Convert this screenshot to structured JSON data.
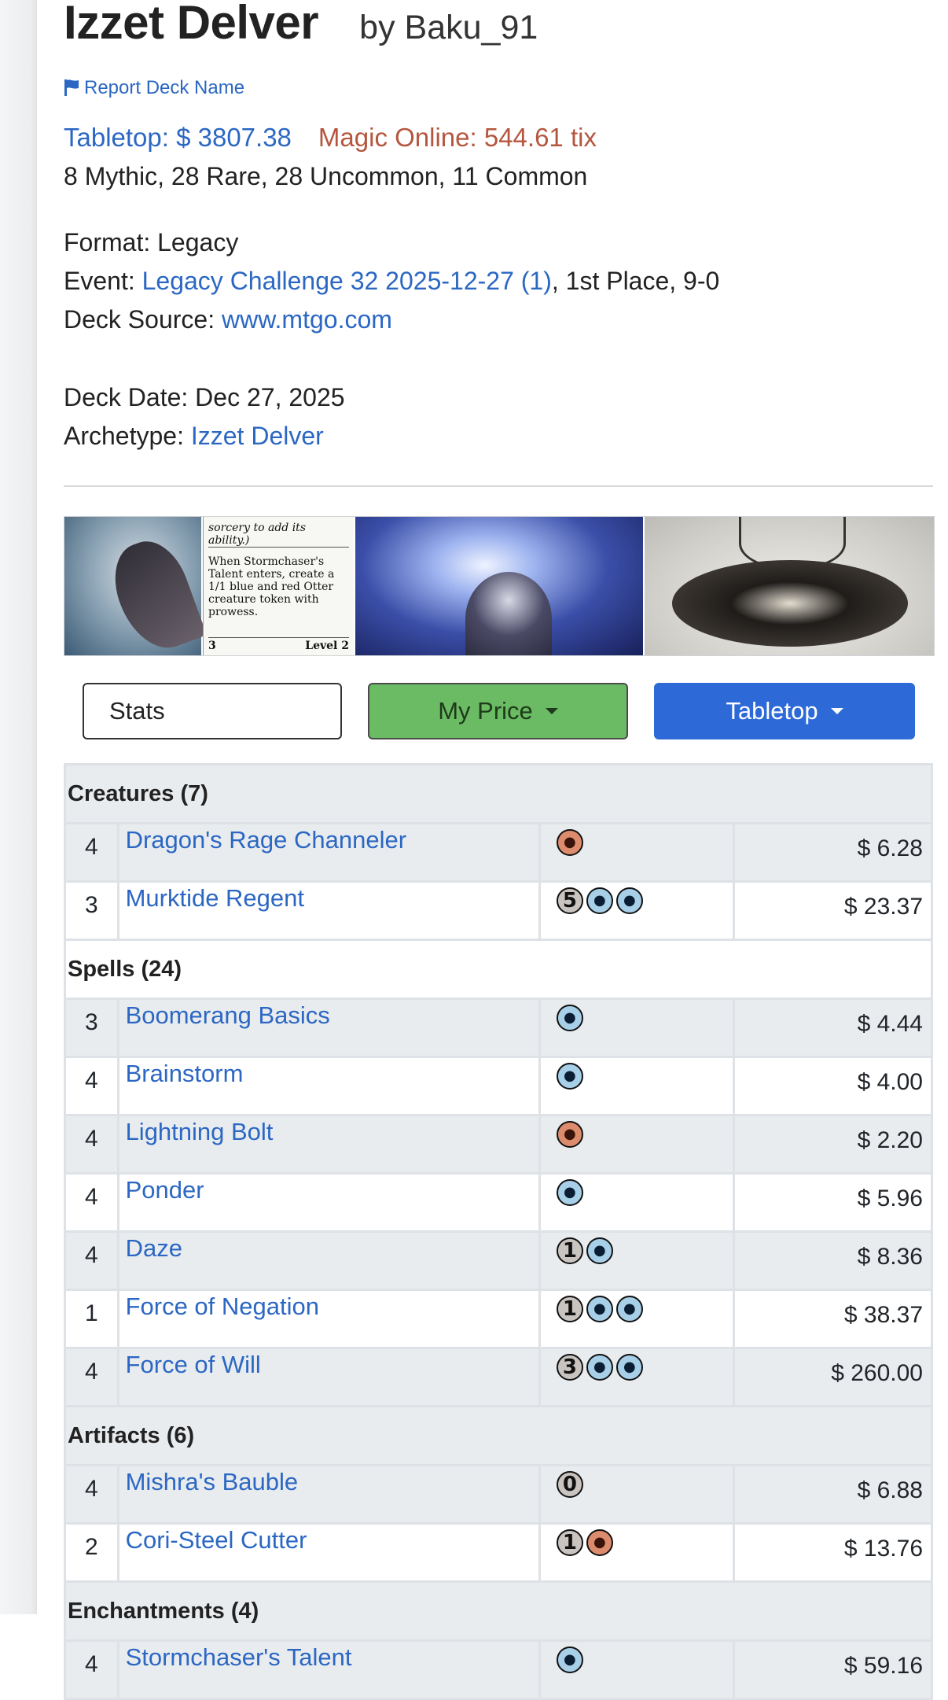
{
  "deck": {
    "title": "Izzet Delver",
    "byline": "by Baku_91",
    "report_link": "Report Deck Name",
    "tabletop_price": "Tabletop: $ 3807.38",
    "mtgo_price": "Magic Online: 544.61 tix",
    "rarity_summary": "8 Mythic, 28 Rare, 28 Uncommon, 11 Common",
    "format_label": "Format: Legacy",
    "event_label": "Event: ",
    "event_link": "Legacy Challenge 32 2025-12-27 (1)",
    "event_result": ", 1st Place, 9-0",
    "source_label": "Deck Source: ",
    "source_link": "www.mtgo.com",
    "date_label": "Deck Date: Dec 27, 2025",
    "archetype_label": "Archetype: ",
    "archetype_link": "Izzet Delver"
  },
  "card_image_text": {
    "ability_reminder": "sorcery to add its ability.)",
    "ability_text": "When Stormchaser's Talent enters, create a 1/1 blue and red Otter creature token with prowess.",
    "level_cost": "3",
    "level_label": "Level 2"
  },
  "buttons": {
    "stats": "Stats",
    "my_price": "My Price",
    "tabletop": "Tabletop"
  },
  "colors": {
    "link": "#2b67c3",
    "mtgo": "#b5573f",
    "my_price_bg": "#6abb64",
    "tabletop_bg": "#2d6ad8",
    "blue_mana": "#a7cfe8",
    "red_mana": "#dc8c6c",
    "generic_mana": "#c9c4bf"
  },
  "sections": [
    {
      "title": "Creatures (7)",
      "cards": [
        {
          "qty": "4",
          "name": "Dragon's Rage Channeler",
          "mana": [
            {
              "type": "red",
              "icon": "red-mana-icon"
            }
          ],
          "price": "$ 6.28"
        },
        {
          "qty": "3",
          "name": "Murktide Regent",
          "mana": [
            {
              "type": "generic",
              "text": "5"
            },
            {
              "type": "blue",
              "icon": "blue-mana-icon"
            },
            {
              "type": "blue",
              "icon": "blue-mana-icon"
            }
          ],
          "price": "$ 23.37"
        }
      ]
    },
    {
      "title": "Spells (24)",
      "cards": [
        {
          "qty": "3",
          "name": "Boomerang Basics",
          "mana": [
            {
              "type": "blue",
              "icon": "blue-mana-icon"
            }
          ],
          "price": "$ 4.44"
        },
        {
          "qty": "4",
          "name": "Brainstorm",
          "mana": [
            {
              "type": "blue",
              "icon": "blue-mana-icon"
            }
          ],
          "price": "$ 4.00"
        },
        {
          "qty": "4",
          "name": "Lightning Bolt",
          "mana": [
            {
              "type": "red",
              "icon": "red-mana-icon"
            }
          ],
          "price": "$ 2.20"
        },
        {
          "qty": "4",
          "name": "Ponder",
          "mana": [
            {
              "type": "blue",
              "icon": "blue-mana-icon"
            }
          ],
          "price": "$ 5.96"
        },
        {
          "qty": "4",
          "name": "Daze",
          "mana": [
            {
              "type": "generic",
              "text": "1"
            },
            {
              "type": "blue",
              "icon": "blue-mana-icon"
            }
          ],
          "price": "$ 8.36"
        },
        {
          "qty": "1",
          "name": "Force of Negation",
          "mana": [
            {
              "type": "generic",
              "text": "1"
            },
            {
              "type": "blue",
              "icon": "blue-mana-icon"
            },
            {
              "type": "blue",
              "icon": "blue-mana-icon"
            }
          ],
          "price": "$ 38.37"
        },
        {
          "qty": "4",
          "name": "Force of Will",
          "mana": [
            {
              "type": "generic",
              "text": "3"
            },
            {
              "type": "blue",
              "icon": "blue-mana-icon"
            },
            {
              "type": "blue",
              "icon": "blue-mana-icon"
            }
          ],
          "price": "$ 260.00"
        }
      ]
    },
    {
      "title": "Artifacts (6)",
      "cards": [
        {
          "qty": "4",
          "name": "Mishra's Bauble",
          "mana": [
            {
              "type": "generic",
              "text": "0"
            }
          ],
          "price": "$ 6.88"
        },
        {
          "qty": "2",
          "name": "Cori-Steel Cutter",
          "mana": [
            {
              "type": "generic",
              "text": "1"
            },
            {
              "type": "red",
              "icon": "red-mana-icon"
            }
          ],
          "price": "$ 13.76"
        }
      ]
    },
    {
      "title": "Enchantments (4)",
      "cards": [
        {
          "qty": "4",
          "name": "Stormchaser's Talent",
          "mana": [
            {
              "type": "blue",
              "icon": "blue-mana-icon"
            }
          ],
          "price": "$ 59.16"
        }
      ]
    }
  ]
}
